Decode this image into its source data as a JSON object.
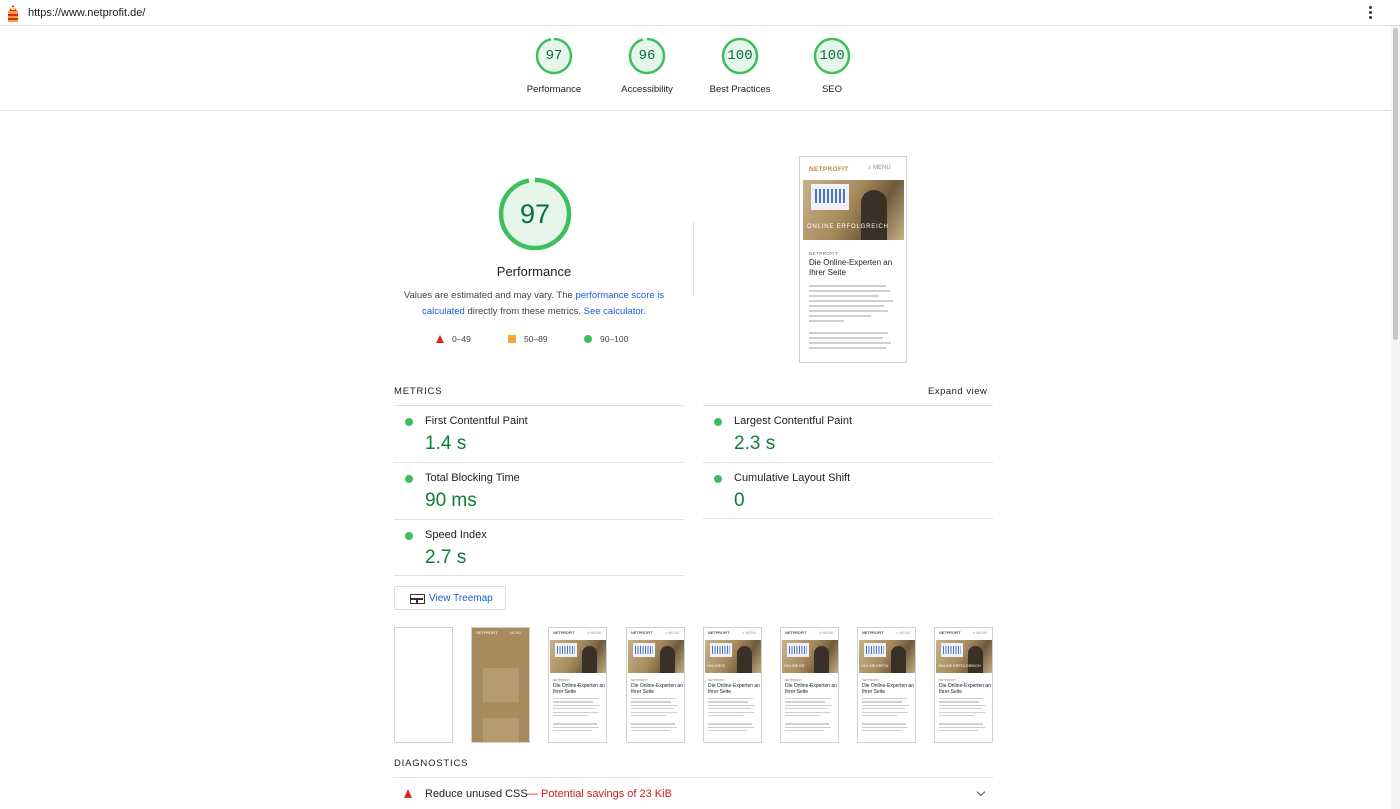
{
  "browser": {
    "url": "https://www.netprofit.de/"
  },
  "score_header": [
    {
      "score": "97",
      "label": "Performance"
    },
    {
      "score": "96",
      "label": "Accessibility"
    },
    {
      "score": "100",
      "label": "Best Practices"
    },
    {
      "score": "100",
      "label": "SEO"
    }
  ],
  "performance": {
    "score": "97",
    "title": "Performance",
    "note_prefix": "Values are estimated and may vary. The ",
    "note_link1": "performance score is calculated",
    "note_middle": " directly from these metrics. ",
    "note_link2": "See calculator.",
    "legend": [
      {
        "range": "0–49",
        "color": "#e0251b"
      },
      {
        "range": "50–89",
        "color": "#f4a83a"
      },
      {
        "range": "90–100",
        "color": "#3dbf5d"
      }
    ]
  },
  "screenshot": {
    "brand": "NETPROFIT",
    "menu": "MENÜ",
    "banner": "ONLINE ERFOLGREICH",
    "kicker": "NETPROFIT",
    "heading": "Die Online-Experten an Ihrer Seite"
  },
  "metrics": {
    "title": "METRICS",
    "expand": "Expand view",
    "items": [
      {
        "name": "First Contentful Paint",
        "value": "1.4 s"
      },
      {
        "name": "Largest Contentful Paint",
        "value": "2.3 s"
      },
      {
        "name": "Total Blocking Time",
        "value": "90 ms"
      },
      {
        "name": "Cumulative Layout Shift",
        "value": "0"
      },
      {
        "name": "Speed Index",
        "value": "2.7 s"
      }
    ]
  },
  "treemap": {
    "label": "View Treemap"
  },
  "filmstrip": {
    "frame_brand": "NETPROFIT",
    "frame_menu": "MENÜ",
    "frame_kicker": "NETPROFIT",
    "frame_heading": "Die Online-Experten an Ihrer Seite",
    "frame_banners": [
      "",
      "",
      "",
      "ONLINE E",
      "ONLINE ER",
      "ONLINE ERFOL",
      "ONLINE ERFOLGREICH"
    ]
  },
  "diagnostics": {
    "title": "DIAGNOSTICS",
    "items": [
      {
        "title": "Reduce unused CSS",
        "savings": "— Potential savings of 23 KiB"
      }
    ]
  },
  "colors": {
    "pass": "#3dbf5d",
    "pass_text": "#0c7d36",
    "fail": "#e0251b",
    "average": "#f4a83a",
    "link": "#1a5cd6"
  }
}
